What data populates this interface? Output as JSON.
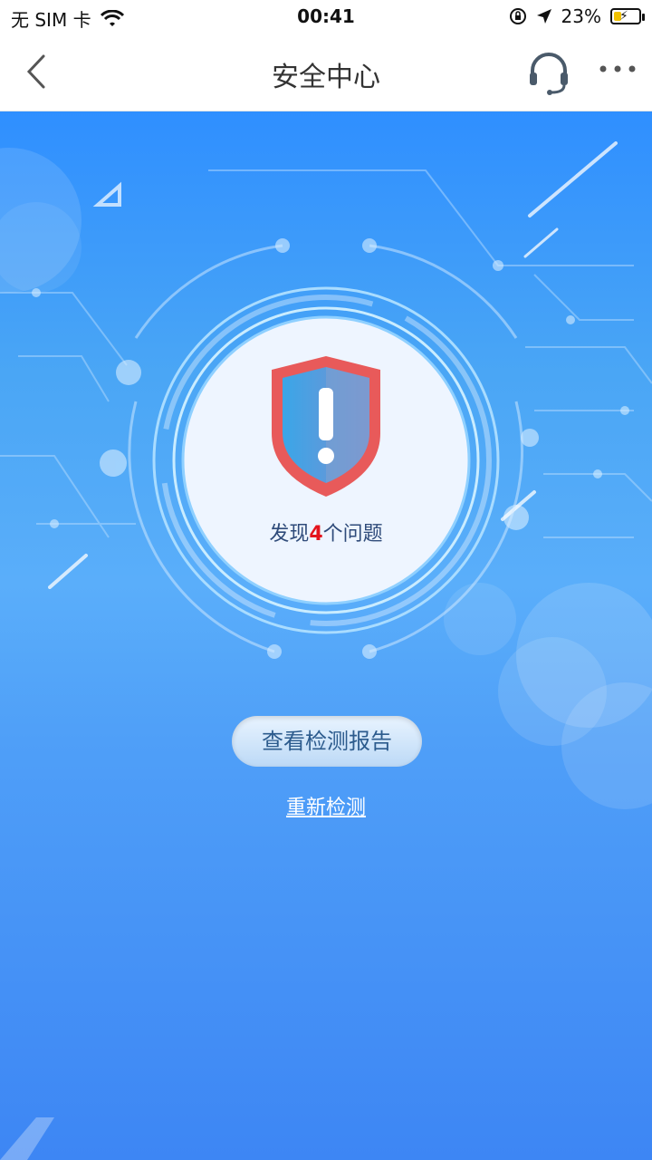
{
  "status_bar": {
    "carrier": "无 SIM 卡",
    "time": "00:41",
    "battery_percent": "23%"
  },
  "header": {
    "title": "安全中心",
    "icons": {
      "back": "chevron-left-icon",
      "support": "headset-icon",
      "more": "ellipsis-icon"
    }
  },
  "scan_result": {
    "prefix": "发现",
    "count": "4",
    "suffix": "个问题",
    "shield_icon": "shield-warning-icon",
    "count_color": "#e4141d"
  },
  "actions": {
    "view_report": "查看检测报告",
    "rescan": "重新检测"
  },
  "colors": {
    "background_top": "#2f8fff",
    "background_bottom": "#3d86f4",
    "shield_red": "#e85a5a"
  }
}
